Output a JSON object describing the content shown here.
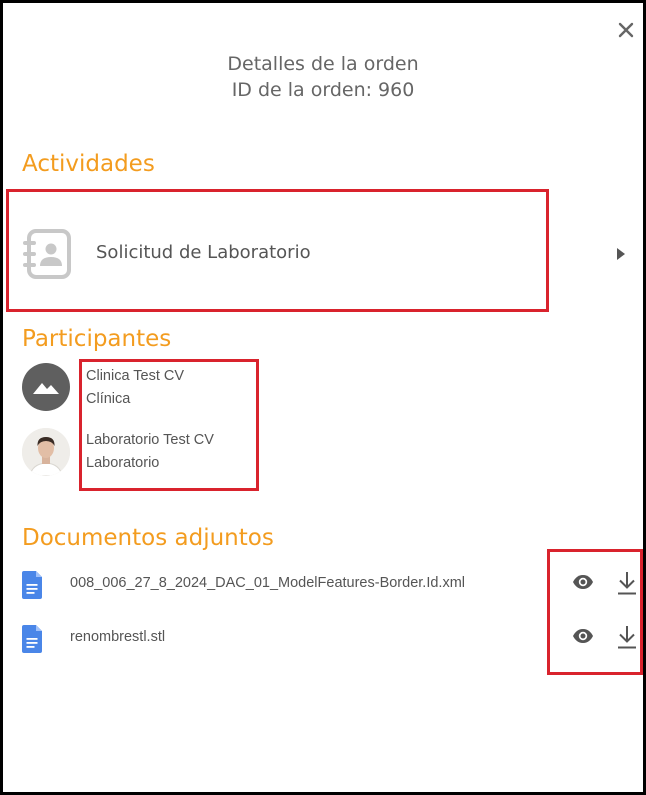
{
  "header": {
    "title_line1": "Detalles de la orden",
    "title_line2": "ID de la orden: 960",
    "close_icon": "close-icon"
  },
  "activities": {
    "heading": "Actividades",
    "item": {
      "label": "Solicitud de Laboratorio",
      "icon": "contact-book-icon",
      "arrow": "caret-right-icon"
    }
  },
  "participants": {
    "heading": "Participantes",
    "items": [
      {
        "name": "Clinica Test CV",
        "role": "Clínica",
        "avatar": "image-placeholder-icon"
      },
      {
        "name": "Laboratorio Test CV",
        "role": "Laboratorio",
        "avatar": "person-photo"
      }
    ]
  },
  "documents": {
    "heading": "Documentos adjuntos",
    "items": [
      {
        "name": "008_006_27_8_2024_DAC_01_ModelFeatures-Border.Id.xml",
        "icon": "document-icon",
        "view_icon": "eye-icon",
        "download_icon": "download-icon"
      },
      {
        "name": "renombrestl.stl",
        "icon": "document-icon",
        "view_icon": "eye-icon",
        "download_icon": "download-icon"
      }
    ]
  },
  "colors": {
    "accent": "#f39c1f",
    "highlight": "#d9232d",
    "doc_blue": "#4a86e8",
    "text": "#555555"
  }
}
